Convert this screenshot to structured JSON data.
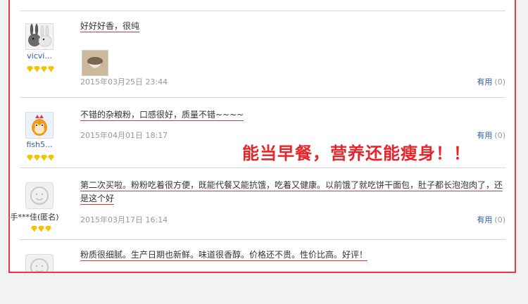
{
  "reviews": [
    {
      "username": "vicvi...",
      "text": "好好好香，很纯",
      "date": "2015年03月25日 23:44",
      "useful_label": "有用",
      "useful_count": "(0)",
      "rank_stars": 4
    },
    {
      "username": "fish5...",
      "text": "不错的杂粮粉，口感很好，质量不错~~~~",
      "date": "2015年04月01日 18:17",
      "useful_label": "有用",
      "useful_count": "(0)",
      "rank_stars": 4
    },
    {
      "username": "手***佳(匿名)",
      "text": "第二次买啦。粉粉吃着很方便，既能代餐又能抗饿，吃着又健康。以前饿了就吃饼干面包，肚子都长泡泡肉了，还是这个好",
      "date": "2015年03月17日 16:14",
      "useful_label": "有用",
      "useful_count": "(0)",
      "rank_stars": 3
    },
    {
      "text": "粉质很细腻。生产日期也新鲜。味道很香醇。价格还不贵。性价比高。好评！"
    }
  ],
  "callout": "能当早餐，营养还能瘦身！！",
  "colors": {
    "accent": "#e23a3f",
    "link": "#3060a8",
    "muted": "#999999"
  }
}
